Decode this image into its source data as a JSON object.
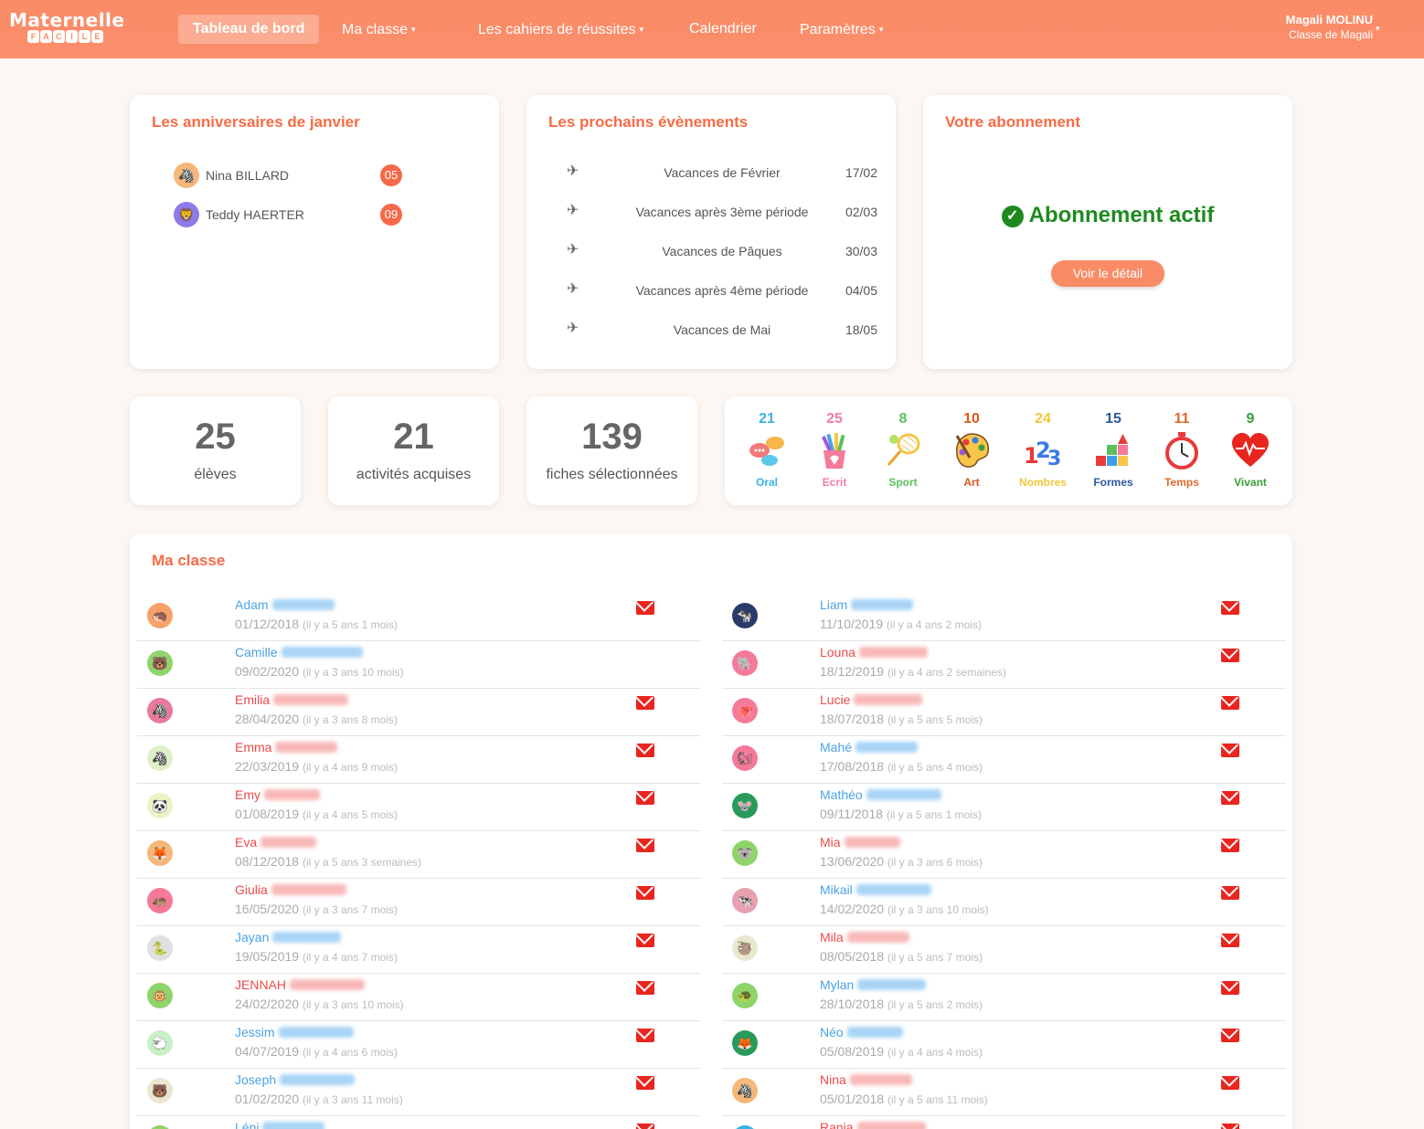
{
  "nav": {
    "logo_top": "Maternelle",
    "logo_bottom": [
      "F",
      "A",
      "C",
      "I",
      "L",
      "E"
    ],
    "items": [
      {
        "label": "Tableau de bord",
        "dropdown": false,
        "active": true
      },
      {
        "label": "Ma classe",
        "dropdown": true
      },
      {
        "label": "Les cahiers de réussites",
        "dropdown": true
      },
      {
        "label": "Calendrier",
        "dropdown": false
      },
      {
        "label": "Paramètres",
        "dropdown": true
      }
    ],
    "user_name": "Magali MOLINU",
    "user_class": "Classe de Magali",
    "caret": "▾"
  },
  "birthdays": {
    "title": "Les anniversaires de janvier",
    "items": [
      {
        "name": "Nina BILLARD",
        "day": "05",
        "avatar": "zebra-icon",
        "color": "#f6b77a"
      },
      {
        "name": "Teddy HAERTER",
        "day": "09",
        "avatar": "lion-icon",
        "color": "#8e7ae8"
      }
    ]
  },
  "events": {
    "title": "Les prochains évènements",
    "icon": "✈",
    "items": [
      {
        "label": "Vacances de Février",
        "date": "17/02"
      },
      {
        "label": "Vacances après 3ème période",
        "date": "02/03"
      },
      {
        "label": "Vacances de Pâques",
        "date": "30/03"
      },
      {
        "label": "Vacances après 4ème période",
        "date": "04/05"
      },
      {
        "label": "Vacances de Mai",
        "date": "18/05"
      }
    ]
  },
  "subscription": {
    "title": "Votre abonnement",
    "status": "Abonnement actif",
    "check": "✓",
    "button": "Voir le détail"
  },
  "stats": [
    {
      "value": "25",
      "label": "élèves"
    },
    {
      "value": "21",
      "label": "activités acquises"
    },
    {
      "value": "139",
      "label": "fiches sélectionnées"
    }
  ],
  "domains": [
    {
      "count": "21",
      "name": "Oral",
      "color": "#3ab3e6",
      "icon": "speech-bubbles-icon"
    },
    {
      "count": "25",
      "name": "Ecrit",
      "color": "#f37ea0",
      "icon": "pencil-cup-icon"
    },
    {
      "count": "8",
      "name": "Sport",
      "color": "#5cc05c",
      "icon": "racket-icon"
    },
    {
      "count": "10",
      "name": "Art",
      "color": "#e0561e",
      "icon": "palette-icon"
    },
    {
      "count": "24",
      "name": "Nombres",
      "color": "#f0c83a",
      "icon": "numbers-icon"
    },
    {
      "count": "15",
      "name": "Formes",
      "color": "#2a5aa0",
      "icon": "shapes-icon"
    },
    {
      "count": "11",
      "name": "Temps",
      "color": "#e06a2a",
      "icon": "stopwatch-icon"
    },
    {
      "count": "9",
      "name": "Vivant",
      "color": "#3aa03a",
      "icon": "heart-icon"
    }
  ],
  "class": {
    "title": "Ma classe",
    "left": [
      {
        "first": "Adam",
        "dob": "01/12/2018",
        "age": "(il y a 5 ans 1 mois)",
        "gender": "m",
        "mail": true,
        "avatar": "hedgehog-icon",
        "color": "#f6a06a"
      },
      {
        "first": "Camille",
        "dob": "09/02/2020",
        "age": "(il y a 3 ans 10 mois)",
        "gender": "m",
        "mail": false,
        "avatar": "bear-icon",
        "color": "#8ed46a"
      },
      {
        "first": "Emilia",
        "dob": "28/04/2020",
        "age": "(il y a 3 ans 8 mois)",
        "gender": "f",
        "mail": true,
        "avatar": "zebra-icon",
        "color": "#e87a9a"
      },
      {
        "first": "Emma",
        "dob": "22/03/2019",
        "age": "(il y a 4 ans 9 mois)",
        "gender": "f",
        "mail": true,
        "avatar": "zebra-icon",
        "color": "#dff0c8"
      },
      {
        "first": "Emy",
        "dob": "01/08/2019",
        "age": "(il y a 4 ans 5 mois)",
        "gender": "f",
        "mail": true,
        "avatar": "panda-icon",
        "color": "#e8f4c8"
      },
      {
        "first": "Eva",
        "dob": "08/12/2018",
        "age": "(il y a 5 ans 3 semaines)",
        "gender": "f",
        "mail": true,
        "avatar": "fox-icon",
        "color": "#f6b77a"
      },
      {
        "first": "Giulia",
        "dob": "16/05/2020",
        "age": "(il y a 3 ans 7 mois)",
        "gender": "f",
        "mail": true,
        "avatar": "hippo-icon",
        "color": "#f57a9a"
      },
      {
        "first": "Jayan",
        "dob": "19/05/2019",
        "age": "(il y a 4 ans 7 mois)",
        "gender": "m",
        "mail": true,
        "avatar": "snake-icon",
        "color": "#e0e0e0"
      },
      {
        "first": "JENNAH",
        "dob": "24/02/2020",
        "age": "(il y a 3 ans 10 mois)",
        "gender": "f",
        "mail": true,
        "avatar": "monkey-icon",
        "color": "#8ed46a"
      },
      {
        "first": "Jessim",
        "dob": "04/07/2019",
        "age": "(il y a 4 ans 6 mois)",
        "gender": "m",
        "mail": true,
        "avatar": "sheep-icon",
        "color": "#c8f0c8"
      },
      {
        "first": "Joseph",
        "dob": "01/02/2020",
        "age": "(il y a 3 ans 11 mois)",
        "gender": "m",
        "mail": true,
        "avatar": "bear-icon",
        "color": "#e8e8d0"
      },
      {
        "first": "Léni",
        "dob": "",
        "age": "",
        "gender": "m",
        "mail": true,
        "avatar": "animal-icon",
        "color": "#8ed46a"
      }
    ],
    "right": [
      {
        "first": "Liam",
        "dob": "11/10/2019",
        "age": "(il y a 4 ans 2 mois)",
        "gender": "m",
        "mail": true,
        "avatar": "cow-icon",
        "color": "#2a3a6a"
      },
      {
        "first": "Louna",
        "dob": "18/12/2019",
        "age": "(il y a 4 ans 2 semaines)",
        "gender": "f",
        "mail": true,
        "avatar": "elephant-icon",
        "color": "#f57a9a"
      },
      {
        "first": "Lucie",
        "dob": "18/07/2018",
        "age": "(il y a 5 ans 5 mois)",
        "gender": "f",
        "mail": true,
        "avatar": "octopus-icon",
        "color": "#f57a9a"
      },
      {
        "first": "Mahé",
        "dob": "17/08/2018",
        "age": "(il y a 5 ans 4 mois)",
        "gender": "m",
        "mail": true,
        "avatar": "squirrel-icon",
        "color": "#f57a9a"
      },
      {
        "first": "Mathéo",
        "dob": "09/11/2018",
        "age": "(il y a 5 ans 1 mois)",
        "gender": "m",
        "mail": true,
        "avatar": "mouse-icon",
        "color": "#2a9a5a"
      },
      {
        "first": "Mia",
        "dob": "13/06/2020",
        "age": "(il y a 3 ans 6 mois)",
        "gender": "f",
        "mail": true,
        "avatar": "koala-icon",
        "color": "#8ed46a"
      },
      {
        "first": "Mikail",
        "dob": "14/02/2020",
        "age": "(il y a 3 ans 10 mois)",
        "gender": "m",
        "mail": true,
        "avatar": "cow-icon",
        "color": "#e8a0b0"
      },
      {
        "first": "Mila",
        "dob": "08/05/2018",
        "age": "(il y a 5 ans 7 mois)",
        "gender": "f",
        "mail": true,
        "avatar": "sloth-icon",
        "color": "#e8e8d0"
      },
      {
        "first": "Mylan",
        "dob": "28/10/2018",
        "age": "(il y a 5 ans 2 mois)",
        "gender": "m",
        "mail": true,
        "avatar": "turtle-icon",
        "color": "#8ed46a"
      },
      {
        "first": "Néo",
        "dob": "05/08/2019",
        "age": "(il y a 4 ans 4 mois)",
        "gender": "m",
        "mail": true,
        "avatar": "fox-icon",
        "color": "#2a9a5a"
      },
      {
        "first": "Nina",
        "dob": "05/01/2018",
        "age": "(il y a 5 ans 11 mois)",
        "gender": "f",
        "mail": true,
        "avatar": "zebra-icon",
        "color": "#f6b77a"
      },
      {
        "first": "Rania",
        "dob": "",
        "age": "",
        "gender": "f",
        "mail": true,
        "avatar": "animal-icon",
        "color": "#3ab3e6"
      }
    ]
  }
}
